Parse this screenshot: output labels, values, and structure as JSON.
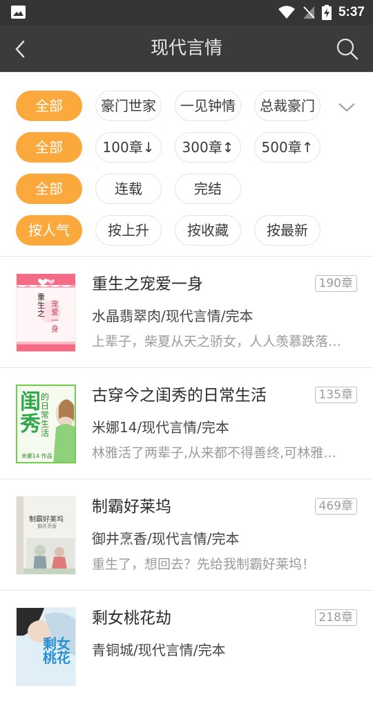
{
  "status_bar": {
    "time": "5:37"
  },
  "header": {
    "title": "现代言情"
  },
  "filters": {
    "category": [
      "全部",
      "豪门世家",
      "一见钟情",
      "总裁豪门"
    ],
    "length": [
      "全部",
      "100章↓",
      "300章↕",
      "500章↑"
    ],
    "status": [
      "全部",
      "连载",
      "完结"
    ],
    "sort": [
      "按人气",
      "按上升",
      "按收藏",
      "按最新"
    ]
  },
  "books": [
    {
      "title": "重生之宠爱一身",
      "meta": "水晶翡翠肉/现代言情/完本",
      "desc": "上辈子，柴夏从天之骄女，人人羡慕跌落尘埃…",
      "chapters": "190章"
    },
    {
      "title": "古穿今之闺秀的日常生活",
      "meta": "米娜14/现代言情/完本",
      "desc": "林雅活了两辈子,从来都不得善终,可林雅…",
      "chapters": "135章"
    },
    {
      "title": "制霸好莱坞",
      "meta": "御井烹香/现代言情/完本",
      "desc": "重生了，想回去？先给我制霸好莱坞！",
      "chapters": "469章"
    },
    {
      "title": "剩女桃花劫",
      "meta": "青铜城/现代言情/完本",
      "desc": "",
      "chapters": "218章"
    }
  ],
  "covers": [
    {
      "lines": [
        "重",
        "生",
        "之",
        "宠",
        "爱",
        "一",
        "身"
      ]
    },
    {
      "big": "闺秀",
      "lines": [
        "的",
        "日",
        "常",
        "生",
        "活"
      ],
      "author": "米娜14 作品"
    },
    {
      "lines": [
        "制霸好莱坞",
        "御井烹香"
      ]
    },
    {
      "lines": [
        "剩",
        "女",
        "桃",
        "花"
      ]
    }
  ],
  "colors": {
    "accent": "#fba83c",
    "appbar": "#3b3b3b",
    "statusbar": "#353535"
  }
}
